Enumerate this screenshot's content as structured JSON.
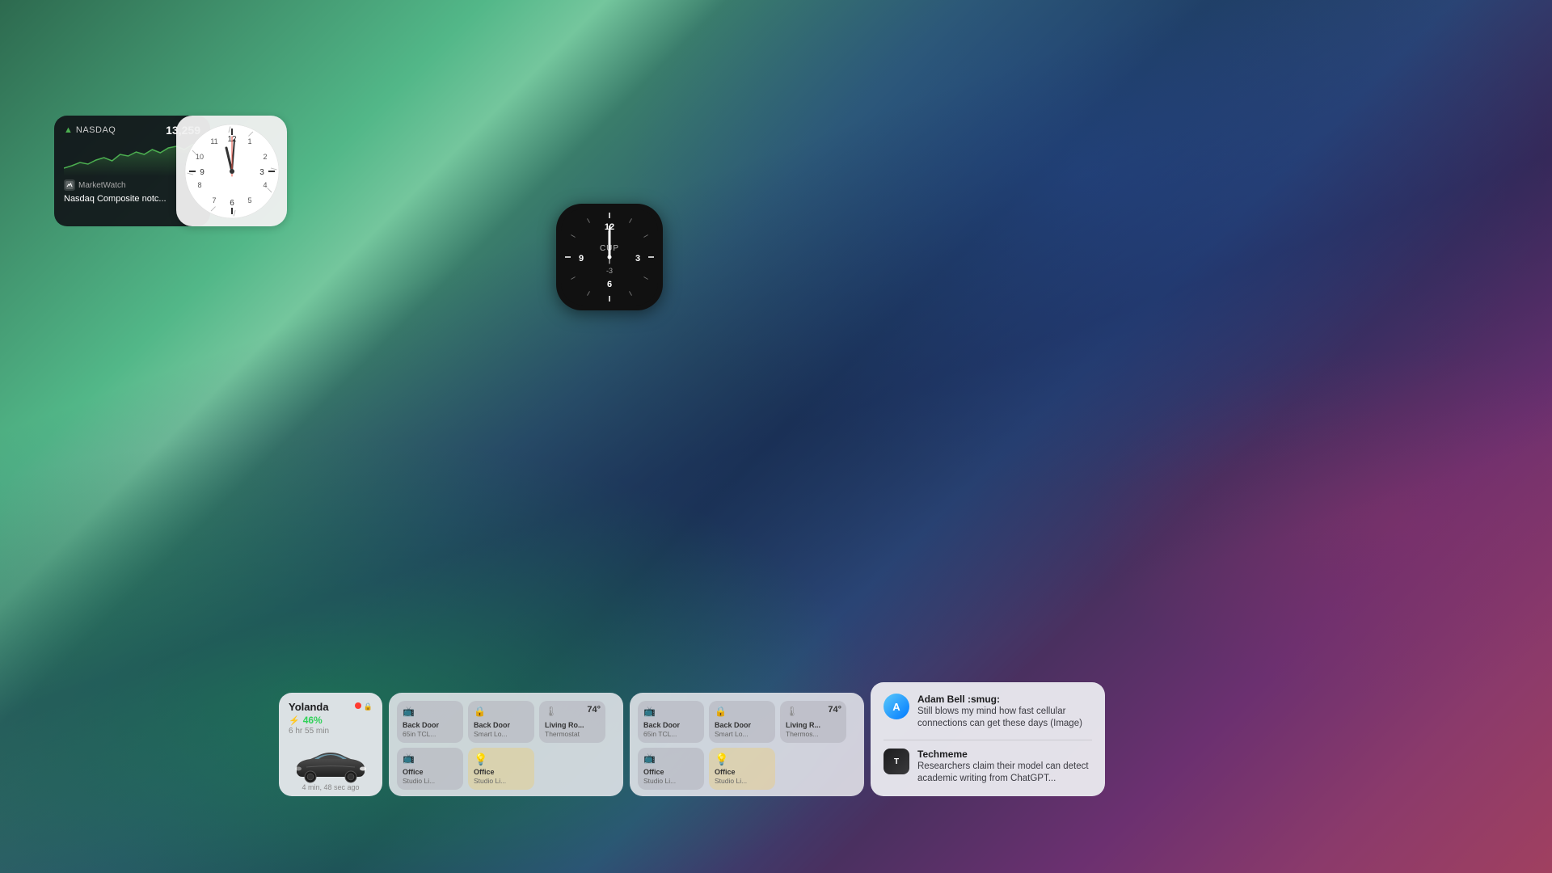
{
  "wallpaper": {
    "description": "macOS Monterey gradient wallpaper"
  },
  "nasdaq_widget": {
    "arrow": "▲",
    "label": "NASDAQ",
    "value": "13,259",
    "description": "Nasdaq Composite notc...",
    "source": "MarketWatch"
  },
  "clock_widget": {
    "type": "analog",
    "hour": 11,
    "minute": 58
  },
  "watch_face": {
    "type": "dark analog",
    "label": "CUP",
    "top_number": "12",
    "right_number": "3",
    "bottom_number": "-3",
    "bottom2_number": "6",
    "left_number": "9"
  },
  "car_widget": {
    "name": "Yolanda",
    "battery_pct": "46%",
    "charge_time": "6 hr 55 min",
    "timestamp": "4 min, 48 sec ago"
  },
  "home_group_1": {
    "tiles": [
      {
        "icon": "door",
        "name": "Back Door",
        "sub": "65in TCL...",
        "type": "lock"
      },
      {
        "icon": "lock",
        "name": "Back Door",
        "sub": "Smart Lo...",
        "type": "lock"
      },
      {
        "icon": "thermo",
        "name": "Living Ro...",
        "sub": "Thermostat",
        "temp": "74°",
        "type": "temp"
      },
      {
        "icon": "tv",
        "name": "Office",
        "sub": "Studio Li...",
        "type": "off"
      },
      {
        "icon": "light",
        "name": "Office",
        "sub": "Studio Li...",
        "type": "light-yellow"
      }
    ]
  },
  "home_group_2": {
    "tiles": [
      {
        "icon": "door",
        "name": "Back Door",
        "sub": "65in TCL...",
        "type": "lock"
      },
      {
        "icon": "lock",
        "name": "Back Door",
        "sub": "Smart Lo...",
        "type": "lock"
      },
      {
        "icon": "thermo",
        "name": "Living R...",
        "sub": "Thermos...",
        "temp": "74°",
        "type": "temp"
      },
      {
        "icon": "tv",
        "name": "Office",
        "sub": "Studio Li...",
        "type": "off"
      },
      {
        "icon": "light",
        "name": "Office",
        "sub": "Studio Li...",
        "type": "light-yellow"
      }
    ]
  },
  "notifications": {
    "items": [
      {
        "avatar_letter": "A",
        "sender": "Adam Bell :smug:",
        "text": "Still blows my mind how fast cellular connections can get these days (Image)"
      },
      {
        "avatar_letter": "T",
        "sender": "Techmeme",
        "text": "Researchers claim their model can detect academic writing from ChatGPT..."
      }
    ]
  }
}
